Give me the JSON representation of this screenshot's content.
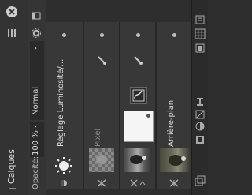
{
  "panel": {
    "title": "Calques"
  },
  "controls": {
    "opacity_label": "Opacité:",
    "opacity_value": "100 %",
    "blend_mode": "Normal"
  },
  "layers": [
    {
      "name": "Réglage Luminosité/...",
      "thumb": "brightness-adjustment"
    },
    {
      "name": "Pixel",
      "thumb": "pixel-image"
    },
    {
      "name": "",
      "thumb": "mask-and-photo"
    },
    {
      "name": "Arrière-plan",
      "thumb": "background-photo"
    }
  ],
  "colors": {
    "bg": "#2e2e2e",
    "panel": "#383838",
    "text": "#cfcfcf"
  }
}
